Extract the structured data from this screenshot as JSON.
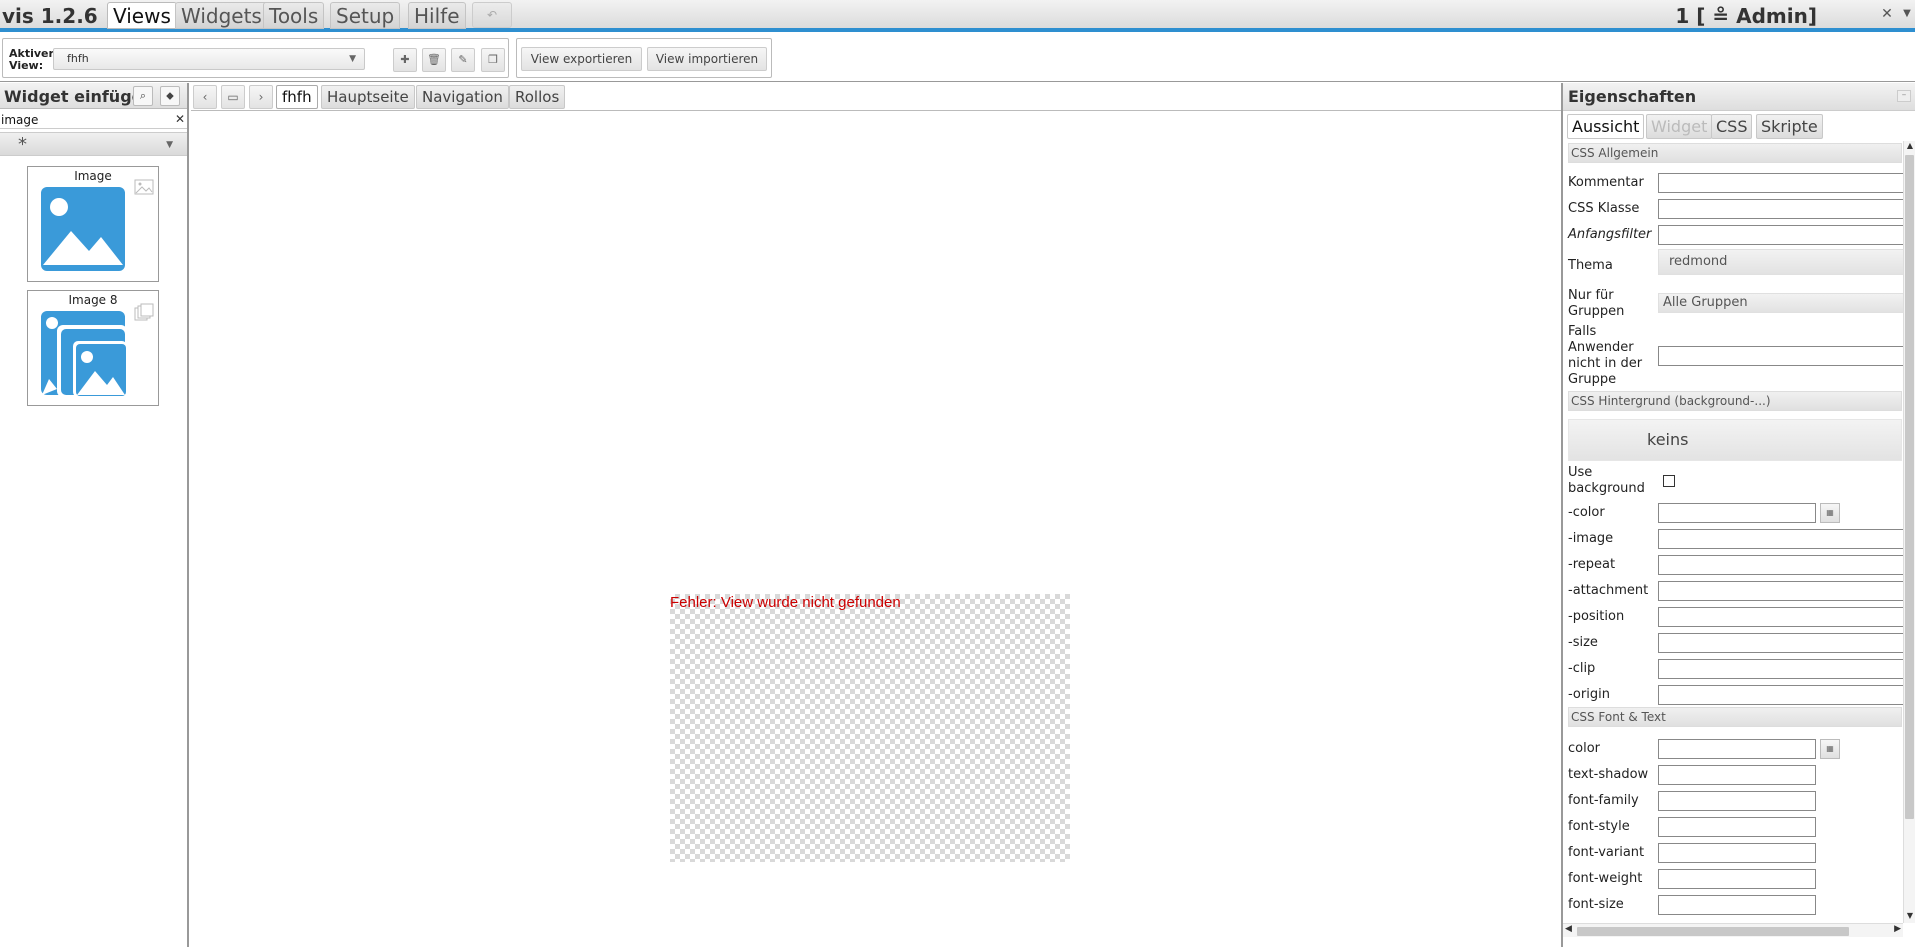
{
  "app": {
    "title": "vis 1.2.6",
    "user": "1 [ ≗ Admin]"
  },
  "menu": {
    "tabs": [
      "Views",
      "Widgets",
      "Tools",
      "Setup",
      "Hilfe"
    ],
    "active": "Views",
    "undo_icon": "undo-icon"
  },
  "toolbar": {
    "active_view_label": "Aktiver View:",
    "active_view_value": "fhfh",
    "export_label": "View exportieren",
    "import_label": "View importieren"
  },
  "left": {
    "title": "Widget einfügen",
    "filter_value": "image",
    "clear_label": "✕",
    "category": "*",
    "widgets": [
      {
        "name": "Image",
        "icon": "image-icon"
      },
      {
        "name": "Image 8",
        "icon": "image-stack-icon"
      }
    ]
  },
  "main": {
    "tabs": [
      "fhfh",
      "Hauptseite",
      "Navigation",
      "Rollos"
    ],
    "active_tab": "fhfh",
    "error_text": "Fehler: View wurde nicht gefunden"
  },
  "props": {
    "title": "Eigenschaften",
    "tabs": [
      "Aussicht",
      "Widget",
      "CSS",
      "Skripte"
    ],
    "active_tab": "Aussicht",
    "sections": {
      "general": "CSS Allgemein",
      "background": "CSS Hintergrund (background-...)",
      "font": "CSS Font & Text"
    },
    "labels": {
      "kommentar": "Kommentar",
      "css_klasse": "CSS Klasse",
      "anfangsfilter": "Anfangsfilter",
      "thema": "Thema",
      "nur_fuer_gruppen": "Nur für Gruppen",
      "falls_anwender": "Falls Anwender nicht in der Gruppe",
      "use_background": "Use background",
      "bg_color": "-color",
      "bg_image": "-image",
      "bg_repeat": "-repeat",
      "bg_attachment": "-attachment",
      "bg_position": "-position",
      "bg_size": "-size",
      "bg_clip": "-clip",
      "bg_origin": "-origin",
      "color": "color",
      "text_shadow": "text-shadow",
      "font_family": "font-family",
      "font_style": "font-style",
      "font_variant": "font-variant",
      "font_weight": "font-weight",
      "font_size": "font-size"
    },
    "values": {
      "thema": "redmond",
      "nur_fuer_gruppen": "Alle Gruppen",
      "background": "keins"
    }
  },
  "colors": {
    "accent": "#2e8fd0",
    "error": "#cc0000",
    "image_icon": "#3a9ad9"
  }
}
